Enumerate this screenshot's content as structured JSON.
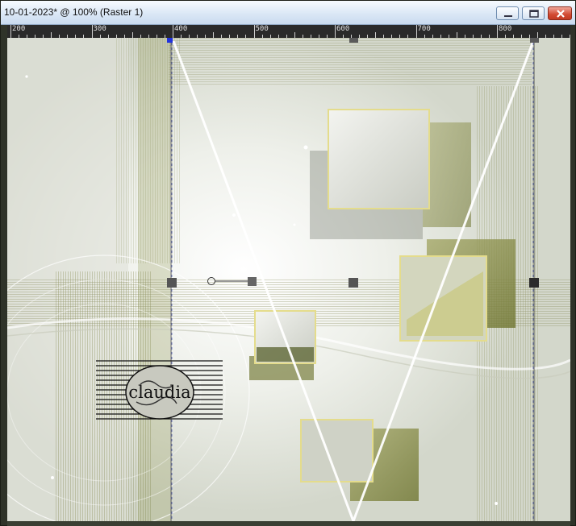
{
  "window": {
    "title": "10-01-2023* @ 100% (Raster 1)",
    "controls": [
      "minimize-icon",
      "restore-icon",
      "close-icon"
    ]
  },
  "ruler": {
    "labels": [
      "200",
      "300",
      "400",
      "500",
      "600",
      "700",
      "800"
    ]
  },
  "canvas": {
    "watermark": "claudia"
  },
  "colors": {
    "titlebar": "#dbe8f6",
    "ruler": "#2a2a2a",
    "canvas_base": "#e4e6dd",
    "olive": "#8a8d3a",
    "frame_yellow": "#e0d88a",
    "guide_blue": "#3344aa"
  }
}
